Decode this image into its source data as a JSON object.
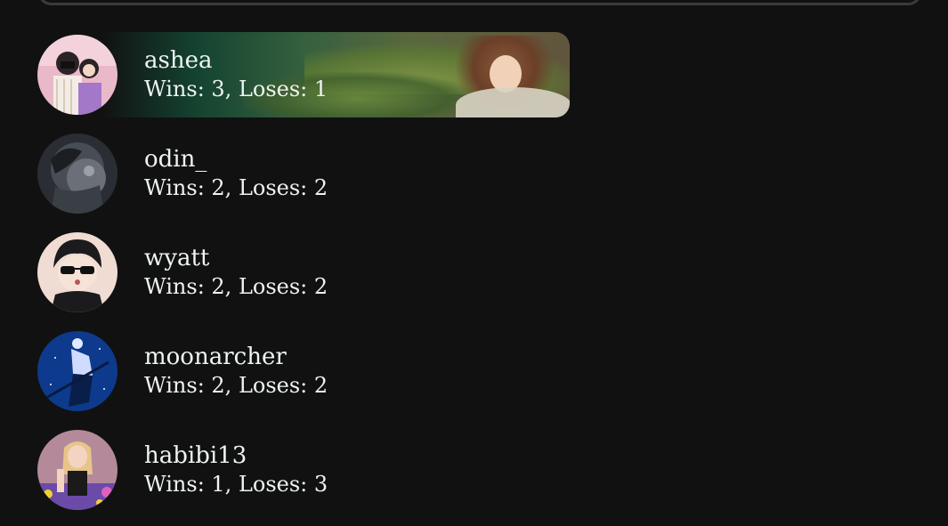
{
  "players": [
    {
      "username": "ashea",
      "record": "Wins: 3, Loses: 1",
      "highlighted": true,
      "avatar_icon": "couple-avatar-icon"
    },
    {
      "username": "odin_",
      "record": "Wins: 2, Loses: 2",
      "highlighted": false,
      "avatar_icon": "armored-knight-avatar-icon"
    },
    {
      "username": "wyatt",
      "record": "Wins: 2, Loses: 2",
      "highlighted": false,
      "avatar_icon": "sunglasses-boy-avatar-icon"
    },
    {
      "username": "moonarcher",
      "record": "Wins: 2, Loses: 2",
      "highlighted": false,
      "avatar_icon": "night-figure-avatar-icon"
    },
    {
      "username": "habibi13",
      "record": "Wins: 1, Loses: 3",
      "highlighted": false,
      "avatar_icon": "girl-selfie-avatar-icon"
    }
  ],
  "colors": {
    "background": "#111112",
    "text": "#eef3f3",
    "highlight_green": "#1d5a44"
  }
}
